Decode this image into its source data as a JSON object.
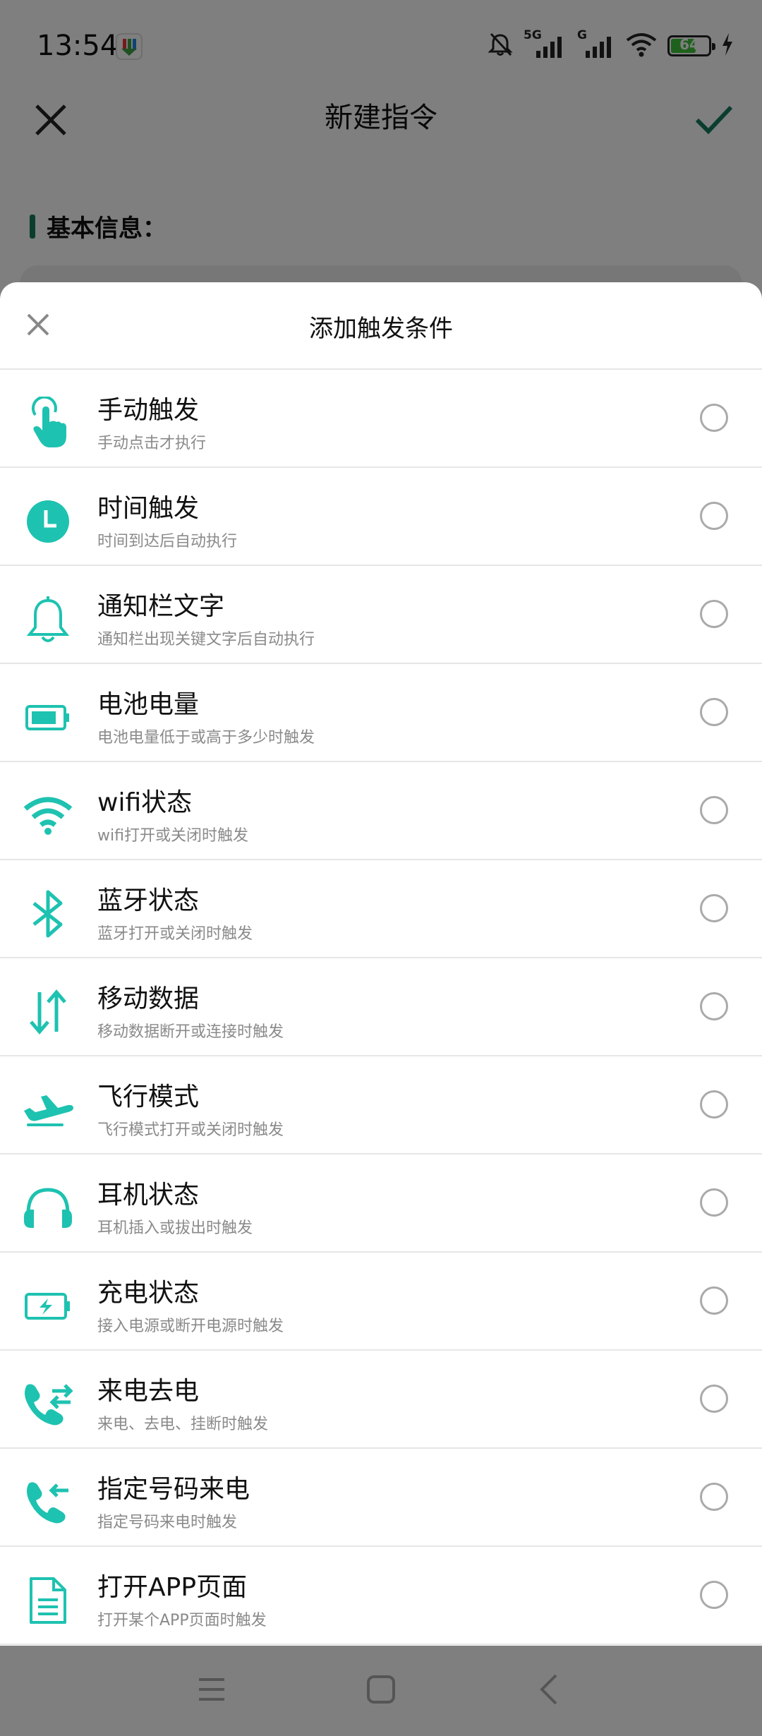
{
  "status": {
    "time": "13:54",
    "network_5g": "5G",
    "network_g": "G",
    "battery": "64"
  },
  "page": {
    "title": "新建指令",
    "section": "基本信息："
  },
  "sheet": {
    "title": "添加触发条件",
    "items": [
      {
        "title": "手动触发",
        "subtitle": "手动点击才执行",
        "icon": "tap-hand-icon"
      },
      {
        "title": "时间触发",
        "subtitle": "时间到达后自动执行",
        "icon": "clock-icon"
      },
      {
        "title": "通知栏文字",
        "subtitle": "通知栏出现关键文字后自动执行",
        "icon": "bell-icon"
      },
      {
        "title": "电池电量",
        "subtitle": "电池电量低于或高于多少时触发",
        "icon": "battery-icon"
      },
      {
        "title": "wifi状态",
        "subtitle": "wifi打开或关闭时触发",
        "icon": "wifi-icon"
      },
      {
        "title": "蓝牙状态",
        "subtitle": "蓝牙打开或关闭时触发",
        "icon": "bluetooth-icon"
      },
      {
        "title": "移动数据",
        "subtitle": "移动数据断开或连接时触发",
        "icon": "mobile-data-icon"
      },
      {
        "title": "飞行模式",
        "subtitle": "飞行模式打开或关闭时触发",
        "icon": "airplane-icon"
      },
      {
        "title": "耳机状态",
        "subtitle": "耳机插入或拔出时触发",
        "icon": "headphones-icon"
      },
      {
        "title": "充电状态",
        "subtitle": "接入电源或断开电源时触发",
        "icon": "charging-icon"
      },
      {
        "title": "来电去电",
        "subtitle": "来电、去电、挂断时触发",
        "icon": "phone-transfer-icon"
      },
      {
        "title": "指定号码来电",
        "subtitle": "指定号码来电时触发",
        "icon": "phone-incoming-icon"
      },
      {
        "title": "打开APP页面",
        "subtitle": "打开某个APP页面时触发",
        "icon": "document-icon"
      }
    ]
  },
  "colors": {
    "accent": "#1ec2b0",
    "confirm": "#177a5f",
    "section_bar": "#177a5f"
  }
}
